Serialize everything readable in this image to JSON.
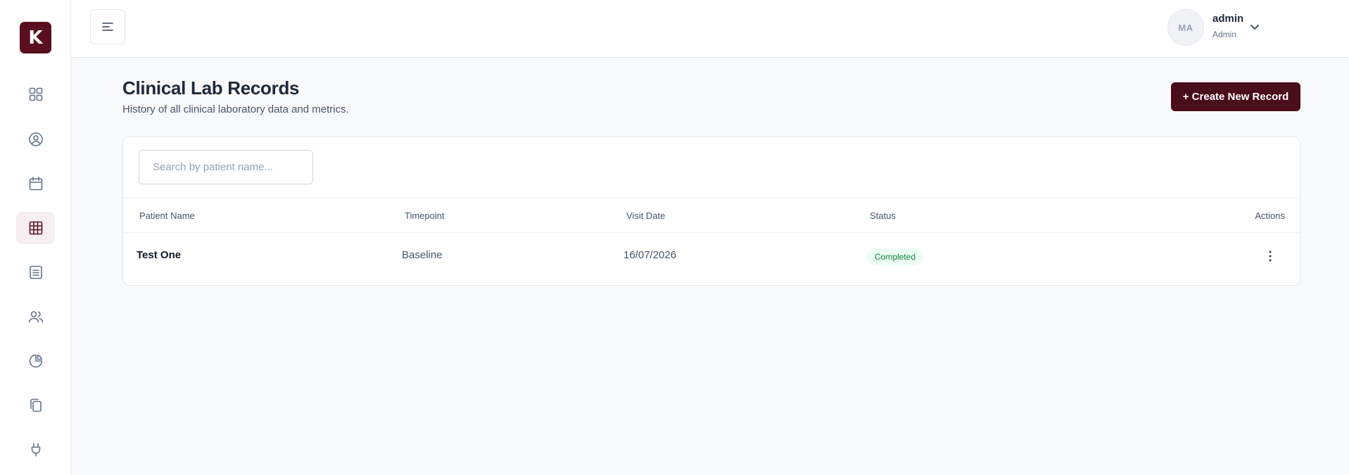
{
  "app": {
    "logo_letter": "K"
  },
  "sidebar": {
    "items": [
      {
        "icon": "dashboard-icon",
        "active": false
      },
      {
        "icon": "user-circle-icon",
        "active": false
      },
      {
        "icon": "calendar-icon",
        "active": false
      },
      {
        "icon": "table-grid-icon",
        "active": true
      },
      {
        "icon": "document-list-icon",
        "active": false
      },
      {
        "icon": "users-icon",
        "active": false
      },
      {
        "icon": "pie-chart-icon",
        "active": false
      },
      {
        "icon": "copy-files-icon",
        "active": false
      },
      {
        "icon": "plug-icon",
        "active": false
      }
    ]
  },
  "topbar": {
    "menu_icon": "menu-icon",
    "user": {
      "initials": "MA",
      "name": "admin",
      "role": "Admin"
    },
    "dropdown_icon": "chevron-down-icon"
  },
  "page": {
    "title": "Clinical Lab Records",
    "subtitle": "History of all clinical laboratory data and metrics.",
    "create_button": "+ Create New Record"
  },
  "search": {
    "placeholder": "Search by patient name...",
    "value": ""
  },
  "table": {
    "headers": {
      "patient_name": "Patient Name",
      "timepoint": "Timepoint",
      "visit_date": "Visit Date",
      "status": "Status",
      "actions": "Actions"
    },
    "rows": [
      {
        "patient_name": "Test One",
        "timepoint": "Baseline",
        "visit_date": "16/07/2026",
        "status": "Completed"
      }
    ]
  },
  "colors": {
    "brand": "#5a0f1e",
    "button": "#4a0d1a",
    "status_completed_bg": "#ecfdf3",
    "status_completed_text": "#15803d",
    "page_bg": "#f8f9fb"
  }
}
